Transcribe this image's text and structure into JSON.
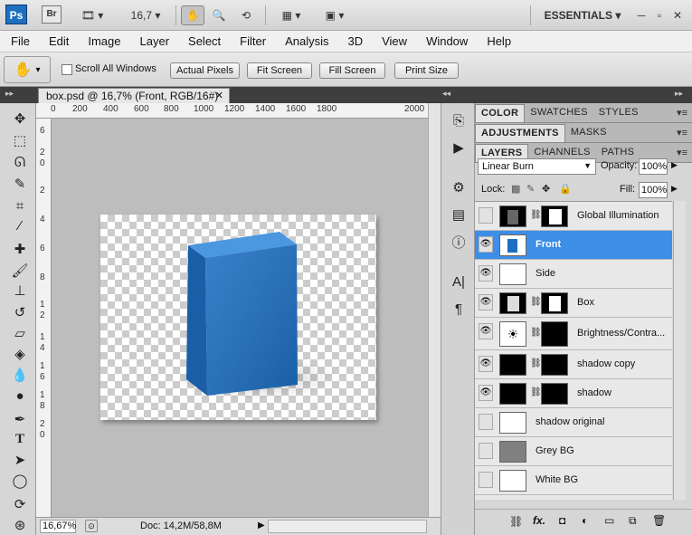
{
  "app": {
    "logo": "Ps",
    "bridge": "Br",
    "zoom": "16,7",
    "workspace": "ESSENTIALS",
    "window_controls": [
      "minimize-icon",
      "maximize-icon",
      "close-icon"
    ]
  },
  "menu": [
    "File",
    "Edit",
    "Image",
    "Layer",
    "Select",
    "Filter",
    "Analysis",
    "3D",
    "View",
    "Window",
    "Help"
  ],
  "options": {
    "scroll_all": "Scroll All Windows",
    "actual_pixels": "Actual Pixels",
    "fit_screen": "Fit Screen",
    "fill_screen": "Fill Screen",
    "print_size": "Print Size"
  },
  "document": {
    "tab_title": "box.psd @ 16,7% (Front, RGB/16#)",
    "ruler_h": [
      "0",
      "200",
      "400",
      "600",
      "800",
      "1000",
      "1200",
      "1400",
      "1600",
      "1800",
      "2000"
    ],
    "ruler_v": [
      "6",
      "2",
      "0",
      "2",
      "4",
      "6",
      "8",
      "1",
      "2",
      "1",
      "4",
      "1",
      "6",
      "1",
      "8",
      "2",
      "0"
    ],
    "status_zoom": "16,67%",
    "status_doc": "Doc: 14,2M/58,8M"
  },
  "panels": {
    "group1": [
      "COLOR",
      "SWATCHES",
      "STYLES"
    ],
    "group2": [
      "ADJUSTMENTS",
      "MASKS"
    ],
    "group3": [
      "LAYERS",
      "CHANNELS",
      "PATHS"
    ]
  },
  "layers_panel": {
    "blend_mode": "Linear Burn",
    "opacity_label": "Opacity:",
    "opacity": "100%",
    "lock_label": "Lock:",
    "fill_label": "Fill:",
    "fill": "100%",
    "layers": [
      {
        "name": "Global Illumination",
        "visible": false,
        "selected": false
      },
      {
        "name": "Front",
        "visible": true,
        "selected": true
      },
      {
        "name": "Side",
        "visible": true,
        "selected": false
      },
      {
        "name": "Box",
        "visible": true,
        "selected": false
      },
      {
        "name": "Brightness/Contra...",
        "visible": true,
        "selected": false
      },
      {
        "name": "shadow copy",
        "visible": true,
        "selected": false
      },
      {
        "name": "shadow",
        "visible": true,
        "selected": false
      },
      {
        "name": "shadow original",
        "visible": false,
        "selected": false
      },
      {
        "name": "Grey BG",
        "visible": false,
        "selected": false
      },
      {
        "name": "White BG",
        "visible": false,
        "selected": false
      }
    ],
    "footer_icons": [
      "link-icon",
      "fx-icon",
      "mask-icon",
      "adjustment-icon",
      "group-icon",
      "new-layer-icon",
      "trash-icon"
    ]
  },
  "colors": {
    "accent": "#3c8ee6",
    "box": "#1d6fc2"
  }
}
